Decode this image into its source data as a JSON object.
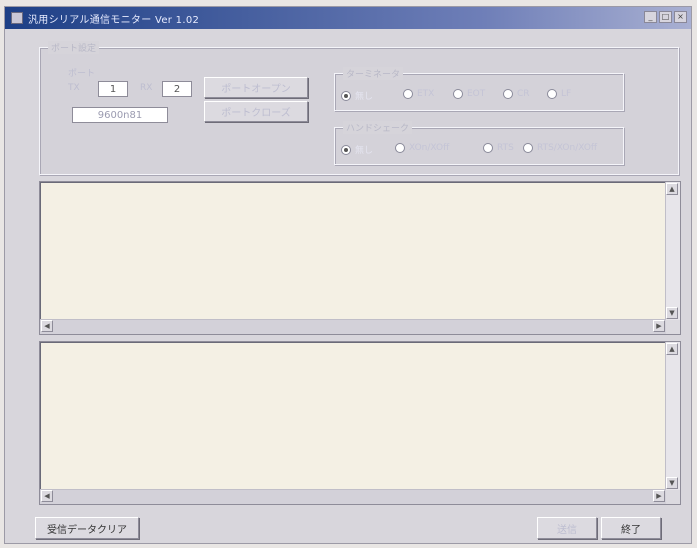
{
  "window": {
    "title": "汎用シリアル通信モニター Ver 1.02",
    "controls": [
      "_",
      "□",
      "×"
    ]
  },
  "settings_group": {
    "legend": "ポート設定",
    "port_label": "ポート",
    "tx_label": "TX",
    "tx_value": "1",
    "rx_label": "RX",
    "rx_value": "2",
    "baud_value": "9600n81",
    "open_button": "ポートオープン",
    "close_button": "ポートクローズ"
  },
  "terminator_group": {
    "legend": "ターミネータ",
    "options": [
      {
        "label": "無し",
        "selected": true
      },
      {
        "label": "ETX",
        "selected": false
      },
      {
        "label": "EOT",
        "selected": false
      },
      {
        "label": "CR",
        "selected": false
      },
      {
        "label": "LF",
        "selected": false
      }
    ]
  },
  "handshake_group": {
    "legend": "ハンドシェーク",
    "options": [
      {
        "label": "無し",
        "selected": true
      },
      {
        "label": "XOn/XOff",
        "selected": false
      },
      {
        "label": "RTS",
        "selected": false
      },
      {
        "label": "RTS/XOn/XOff",
        "selected": false
      }
    ]
  },
  "footer": {
    "clear_button": "受信データクリア",
    "send_button": "送信",
    "exit_button": "終了"
  }
}
